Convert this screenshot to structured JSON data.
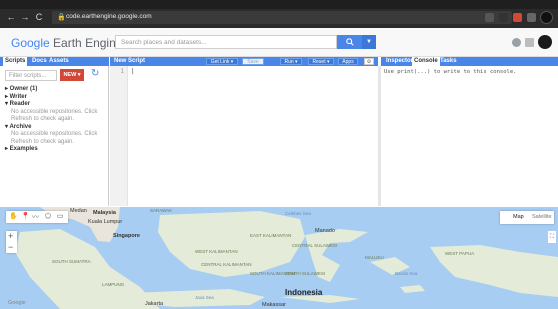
{
  "browser": {
    "url": "code.earthengine.google.com",
    "nav": {
      "back": "←",
      "forward": "→",
      "reload": "C"
    }
  },
  "header": {
    "logo_google": "Google",
    "logo_product": "Earth Engine",
    "search_placeholder": "Search places and datasets...",
    "search_icon": "search-icon",
    "dropdown_icon": "chevron-down-icon"
  },
  "left_panel": {
    "tabs": [
      "Scripts",
      "Docs",
      "Assets"
    ],
    "active_tab": "Scripts",
    "filter_placeholder": "Filter scripts...",
    "new_label": "NEW ▾",
    "tree": [
      {
        "label": "▸ Owner (1)",
        "type": "head"
      },
      {
        "label": "▸ Writer",
        "type": "head"
      },
      {
        "label": "▾ Reader",
        "type": "head"
      },
      {
        "label": "No accessible repositories. Click",
        "type": "sub"
      },
      {
        "label": "Refresh to check again.",
        "type": "sub"
      },
      {
        "label": "▾ Archive",
        "type": "head"
      },
      {
        "label": "No accessible repositories. Click",
        "type": "sub"
      },
      {
        "label": "Refresh to check again.",
        "type": "sub"
      },
      {
        "label": "▸ Examples",
        "type": "head"
      }
    ]
  },
  "editor": {
    "title": "New Script",
    "buttons": {
      "get_link": "Get Link ▾",
      "save": "Save",
      "run": "Run ▾",
      "reset": "Reset ▾",
      "apps": "Apps"
    },
    "line_number": "1",
    "caret": "|"
  },
  "right_panel": {
    "tabs": [
      "Inspector",
      "Console",
      "Tasks"
    ],
    "active_tab": "Console",
    "console_message": "Use print(...) to write to this console."
  },
  "map": {
    "map_type": "Map",
    "satellite": "Satellite",
    "zoom_in": "+",
    "zoom_out": "−",
    "places": {
      "malaysia": "Malaysia",
      "kuala_lumpur": "Kuala Lumpur",
      "singapore": "Singapore",
      "indonesia": "Indonesia",
      "medan": "Medan",
      "jakarta": "Jakarta",
      "makassar": "Makassar",
      "central_kalimantan": "CENTRAL KALIMANTAN",
      "south_kalimantan": "SOUTH KALIMANTAN",
      "east_kalimantan": "EAST KALIMANTAN",
      "west_kalimantan": "WEST KALIMANTAN",
      "sarawak": "SARAWAK",
      "south_sumatra": "SOUTH SUMATRA",
      "lampung": "LAMPUNG",
      "central_sulawesi": "CENTRAL SULAWESI",
      "south_sulawesi": "SOUTH SULAWESI",
      "west_papua": "WEST PAPUA",
      "maluku": "MALUKU",
      "celebes_sea": "Celebes Sea",
      "banda_sea": "Banda Sea",
      "java_sea": "Java Sea",
      "manado": "Manado",
      "google": "Google"
    }
  },
  "colors": {
    "accent_blue": "#4a86e8",
    "new_button_red": "#d14836",
    "water": "#a7cdf2",
    "land": "#e9e5dc"
  }
}
